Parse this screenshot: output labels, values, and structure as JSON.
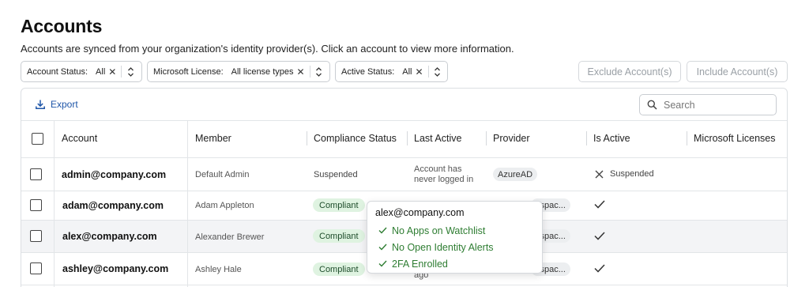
{
  "page": {
    "title": "Accounts",
    "subtitle": "Accounts are synced from your organization's identity provider(s). Click an account to view more information."
  },
  "filters": [
    {
      "label": "Account Status:",
      "value": "All"
    },
    {
      "label": "Microsoft License:",
      "value": "All license types"
    },
    {
      "label": "Active Status:",
      "value": "All"
    }
  ],
  "actions": {
    "exclude": "Exclude Account(s)",
    "include": "Include Account(s)",
    "export": "Export"
  },
  "search": {
    "placeholder": "Search"
  },
  "table": {
    "columns": [
      "Account",
      "Member",
      "Compliance Status",
      "Last Active",
      "Provider",
      "Is Active",
      "Microsoft Licenses"
    ],
    "rows": [
      {
        "account": "admin@company.com",
        "member": "Default Admin",
        "compliance": "Suspended",
        "last_active_1": "Account has",
        "last_active_2": "never logged in",
        "provider": "AzureAD",
        "is_active": "Suspended"
      },
      {
        "account": "adam@company.com",
        "member": "Adam Appleton",
        "compliance": "Compliant",
        "provider": "kspac...",
        "is_active": "check"
      },
      {
        "account": "alex@company.com",
        "member": "Alexander Brewer",
        "compliance": "Compliant",
        "provider": "kspac...",
        "is_active": "check"
      },
      {
        "account": "ashley@company.com",
        "member": "Ashley Hale",
        "compliance": "Compliant",
        "last_active_tail": "ago",
        "provider": "kspac...",
        "is_active": "check"
      }
    ]
  },
  "tooltip": {
    "title": "alex@company.com",
    "items": [
      "No Apps on Watchlist",
      "No Open Identity Alerts",
      "2FA Enrolled"
    ]
  },
  "colors": {
    "link_blue": "#1f56a8",
    "compliant_bg": "#dff3e1",
    "tooltip_green": "#2e7d32"
  }
}
